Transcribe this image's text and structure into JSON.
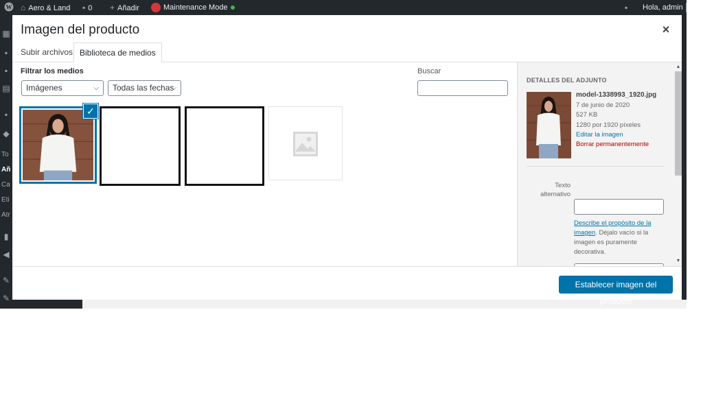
{
  "admin_bar": {
    "site_name": "Aero & Land",
    "comments_count": "0",
    "add_new": "Añadir",
    "maintenance": "Maintenance Mode",
    "greeting": "Hola, admin"
  },
  "sidebar": {
    "fragments": [
      "To",
      "Añ",
      "Ca",
      "Eti",
      "Atr"
    ]
  },
  "modal": {
    "title": "Imagen del producto",
    "close_symbol": "×",
    "tabs": [
      {
        "label": "Subir archivos",
        "active": false
      },
      {
        "label": "Biblioteca de medios",
        "active": true
      }
    ]
  },
  "toolbar": {
    "filter_label": "Filtrar los medios",
    "type_filter": "Imágenes",
    "date_filter": "Todas las fechas",
    "search_label": "Buscar",
    "search_value": ""
  },
  "attachments": [
    {
      "kind": "photo",
      "selected": true
    },
    {
      "kind": "blank",
      "selected": false
    },
    {
      "kind": "blank",
      "selected": false
    },
    {
      "kind": "placeholder",
      "selected": false
    }
  ],
  "details": {
    "heading": "DETALLES DEL ADJUNTO",
    "filename": "model-1338993_1920.jpg",
    "date": "7 de junio de 2020",
    "size": "527 KB",
    "dimensions": "1280 por 1920 píxeles",
    "edit_link": "Editar la imagen",
    "delete_link": "Borrar permanentemente",
    "alt_label": "Texto alternativo",
    "alt_value": "",
    "alt_help_link": "Describe el propósito de la imagen",
    "alt_help_text": ". Déjalo vacío si la imagen es puramente decorativa."
  },
  "footer": {
    "primary_button": "Establecer imagen del producto"
  },
  "colors": {
    "accent": "#0073aa",
    "delete": "#a00",
    "admin_bar": "#23282d"
  }
}
